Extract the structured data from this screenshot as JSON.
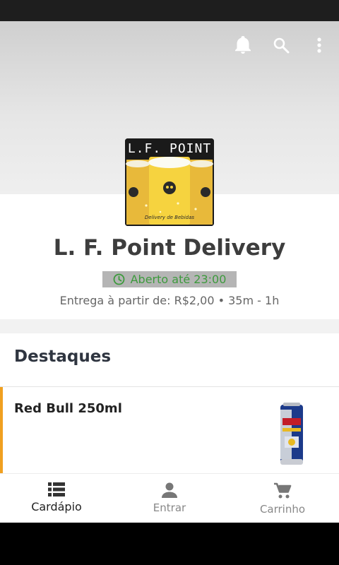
{
  "store": {
    "name": "L. F. Point Delivery",
    "logo_title": "L.F. POINT",
    "logo_tagline": "Delivery de Bebidas",
    "status": "Aberto até 23:00",
    "delivery_info": "Entrega à partir de: R$2,00 • 35m - 1h"
  },
  "header": {
    "icons": [
      "bell-icon",
      "search-icon",
      "more-vert-icon"
    ]
  },
  "highlights": {
    "title": "Destaques",
    "items": [
      {
        "name": "Red Bull 250ml",
        "image": "red-bull-can"
      }
    ]
  },
  "bottom_nav": {
    "items": [
      {
        "label": "Cardápio",
        "icon": "menu-list-icon",
        "active": true
      },
      {
        "label": "Entrar",
        "icon": "person-icon",
        "active": false
      },
      {
        "label": "Carrinho",
        "icon": "cart-icon",
        "active": false
      }
    ]
  },
  "colors": {
    "open_status": "#3d9a3d",
    "accent": "#f0a020"
  }
}
